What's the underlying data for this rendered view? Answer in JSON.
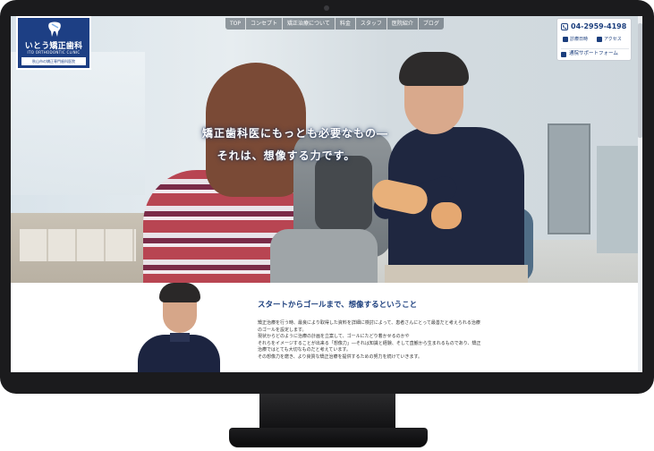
{
  "logo": {
    "name": "いとう矯正歯科",
    "sub": "ITO ORTHODONTIC CLINIC",
    "tag": "秋山市の矯正専門歯科医院"
  },
  "nav": {
    "items": [
      "TOP",
      "コンセプト",
      "矯正治療について",
      "料金",
      "スタッフ",
      "医院紹介",
      "ブログ"
    ]
  },
  "contact": {
    "phone": "04-2959-4198",
    "hours_label": "診療日時",
    "access_label": "アクセス",
    "support_label": "通院サポートフォーム"
  },
  "hero": {
    "tagline_line1": "矯正歯科医にもっとも必要なもの―",
    "tagline_line2": "それは、想像する力です。"
  },
  "section": {
    "title": "スタートからゴールまで、想像するということ",
    "paragraphs": [
      "矯正治療を行う時、最良により取得した資料を詳細に検討によって、患者さんにとって最善だと考えられる治療",
      "のゴールを設定します。",
      "現状からどのように治療の計画を立案して、ゴールにたどり着かせるのかや",
      "それらをイメージすることが出来る「想像力」―それは知識と経験、そして直観から生まれるものであり、矯正",
      "治療ではとても大切なものだと考えています。",
      "その想像力を磨き、より良質な矯正治療を提供するための努力を続けていきます。"
    ]
  },
  "colors": {
    "brand": "#1d3f84",
    "heading": "#1b3e7d",
    "nav_bg": "#505a64"
  }
}
